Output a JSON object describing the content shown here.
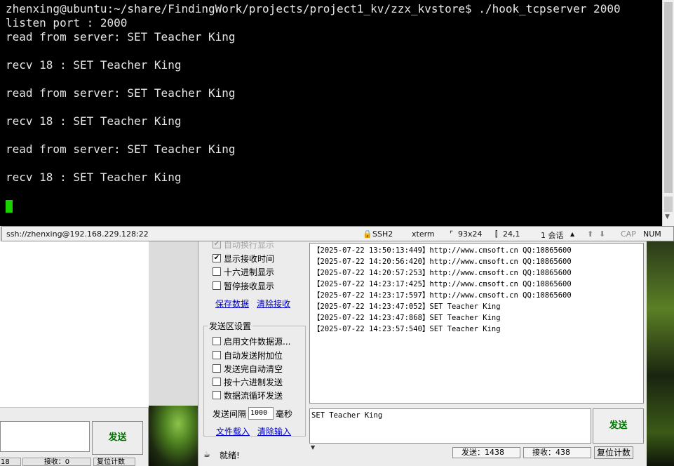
{
  "terminal": {
    "lines": [
      "zhenxing@ubuntu:~/share/FindingWork/projects/project1_kv/zzx_kvstore$ ./hook_tcpserver 2000",
      "listen port : 2000",
      "read from server: SET Teacher King",
      "",
      "recv 18 : SET Teacher King",
      "",
      "read from server: SET Teacher King",
      "",
      "recv 18 : SET Teacher King",
      "",
      "read from server: SET Teacher King",
      "",
      "recv 18 : SET Teacher King",
      ""
    ],
    "status": {
      "connection": "ssh://zhenxing@192.168.229.128:22",
      "protocol": "SSH2",
      "term_type": "xterm",
      "size": "93x24",
      "cursor_pos": "24,1",
      "sessions": "1 会话",
      "cap": "CAP",
      "num": "NUM"
    }
  },
  "serial_tool": {
    "recv_options": [
      {
        "label": "自动换行显示",
        "checked": true,
        "disabled": true
      },
      {
        "label": "显示接收时间",
        "checked": true,
        "disabled": false
      },
      {
        "label": "十六进制显示",
        "checked": false,
        "disabled": false
      },
      {
        "label": "暂停接收显示",
        "checked": false,
        "disabled": false
      }
    ],
    "save_data_link": "保存数据",
    "clear_recv_link": "清除接收",
    "send_group_title": "发送区设置",
    "send_options": [
      {
        "label": "启用文件数据源...",
        "checked": false
      },
      {
        "label": "自动发送附加位",
        "checked": false
      },
      {
        "label": "发送完自动清空",
        "checked": false
      },
      {
        "label": "按十六进制发送",
        "checked": false
      },
      {
        "label": "数据流循环发送",
        "checked": false
      }
    ],
    "interval_label": "发送间隔",
    "interval_value": "1000",
    "interval_unit": "毫秒",
    "file_load_link": "文件载入",
    "clear_input_link": "清除输入",
    "recv_lines": [
      "【2025-07-22 13:50:13:449】http://www.cmsoft.cn QQ:10865600",
      "【2025-07-22 14:20:56:420】http://www.cmsoft.cn QQ:10865600",
      "【2025-07-22 14:20:57:253】http://www.cmsoft.cn QQ:10865600",
      "【2025-07-22 14:23:17:425】http://www.cmsoft.cn QQ:10865600",
      "【2025-07-22 14:23:17:597】http://www.cmsoft.cn QQ:10865600",
      "【2025-07-22 14:23:47:052】SET Teacher King",
      "",
      "【2025-07-22 14:23:47:868】SET Teacher King",
      "",
      "【2025-07-22 14:23:57:540】SET Teacher King"
    ],
    "send_text": "SET Teacher King",
    "send_button": "发送",
    "status_text": "就绪!",
    "sent_count": "发送：1438",
    "recv_count": "接收：438",
    "reset_button": "复位计数"
  },
  "background_window": {
    "send_button": "发送",
    "status_left": "18",
    "status_recv": "接收：0",
    "status_reset": "复位计数"
  }
}
